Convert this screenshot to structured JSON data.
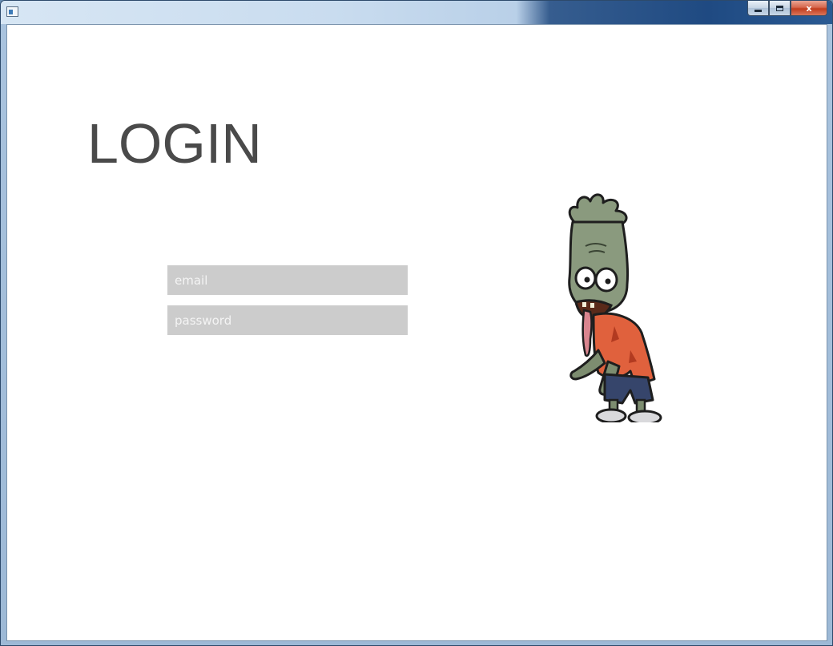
{
  "window": {
    "controls": {
      "minimize": "",
      "maximize": "",
      "close": "x"
    }
  },
  "login": {
    "title": "LOGIN",
    "email_placeholder": "email",
    "password_placeholder": "password"
  },
  "mascot": {
    "icon": "zombie-character"
  },
  "colors": {
    "title_text": "#4a4a4a",
    "field_background": "#cccccc",
    "field_text": "#ffffff",
    "page_background": "#ffffff"
  }
}
